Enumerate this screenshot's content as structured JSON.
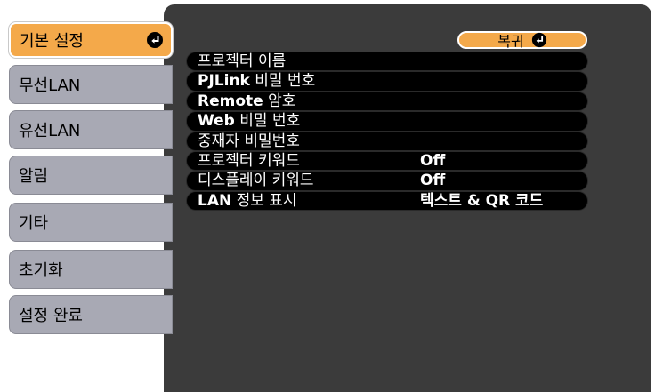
{
  "sidebar": {
    "items": [
      {
        "label": "기본 설정"
      },
      {
        "label": "무선LAN"
      },
      {
        "label": "유선LAN"
      },
      {
        "label": "알림"
      },
      {
        "label": "기타"
      },
      {
        "label": "초기화"
      },
      {
        "label": "설정 완료"
      }
    ]
  },
  "main": {
    "return_label": "복귀",
    "rows": [
      {
        "label_bold": "",
        "label": "프로젝터 이름",
        "value": ""
      },
      {
        "label_bold": "PJLink",
        "label": " 비밀 번호",
        "value": ""
      },
      {
        "label_bold": "Remote",
        "label": " 암호",
        "value": ""
      },
      {
        "label_bold": "Web",
        "label": " 비밀 번호",
        "value": ""
      },
      {
        "label_bold": "",
        "label": "중재자 비밀번호",
        "value": ""
      },
      {
        "label_bold": "",
        "label": "프로젝터 키워드",
        "value": "Off"
      },
      {
        "label_bold": "",
        "label": "디스플레이 키워드",
        "value": "Off"
      },
      {
        "label_bold": "LAN",
        "label": " 정보 표시",
        "value": "텍스트 & QR 코드"
      }
    ]
  },
  "colors": {
    "accent": "#f4a94a",
    "panel": "#3b3b3b",
    "tab": "#a8a9b4"
  },
  "icons": {
    "enter": "enter-icon"
  }
}
